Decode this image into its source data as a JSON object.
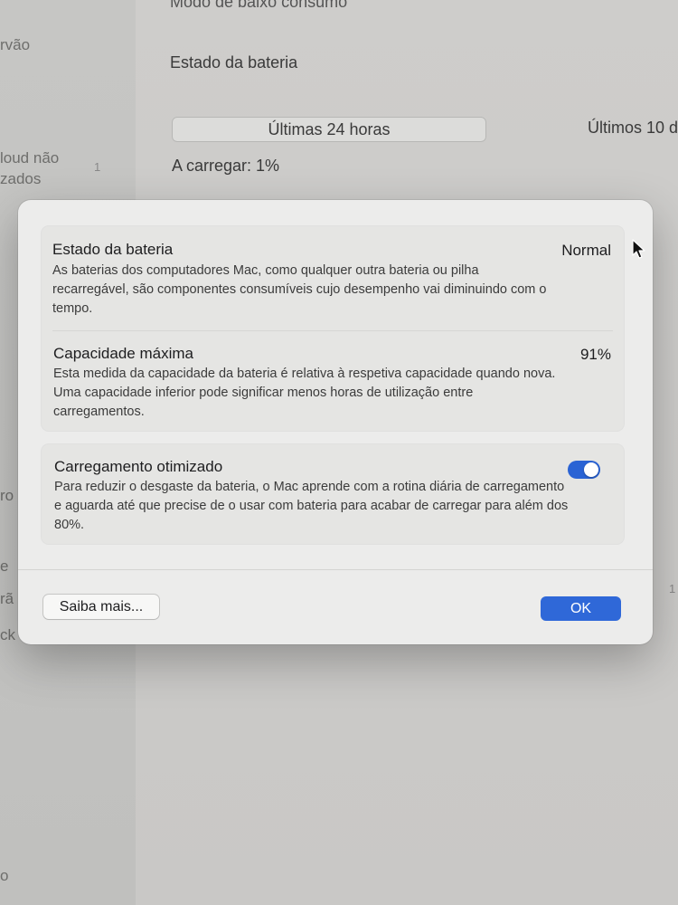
{
  "background": {
    "sidebar": {
      "fragments": [
        "rvão",
        "loud não",
        "zados",
        "ro",
        "e",
        "rã",
        "ck",
        "o"
      ]
    },
    "main": {
      "top_item": "Modo de baixo consumo",
      "section_title": "Estado da bateria",
      "segment_selected": "Últimas 24 horas",
      "segment_other": "Últimos 10 d",
      "charging": "A carregar: 1%",
      "number_left": "1",
      "number_right": "1"
    }
  },
  "dialog": {
    "battery_health": {
      "title": "Estado da bateria",
      "value": "Normal",
      "description": "As baterias dos computadores Mac, como qualquer outra bateria ou pilha recarregável, são componentes consumíveis cujo desempenho vai diminuindo com o tempo."
    },
    "max_capacity": {
      "title": "Capacidade máxima",
      "value": "91%",
      "description": "Esta medida da capacidade da bateria é relativa à respetiva capacidade quando nova. Uma capacidade inferior pode significar menos horas de utilização entre carregamentos."
    },
    "optimized_charging": {
      "title": "Carregamento otimizado",
      "enabled": true,
      "description": "Para reduzir o desgaste da bateria, o Mac aprende com a rotina diária de carregamento e aguarda até que precise de o usar com bateria para acabar de carregar para além dos 80%."
    },
    "learn_more_label": "Saiba mais...",
    "ok_label": "OK"
  },
  "colors": {
    "accent": "#2f68d8",
    "toggle_on": "#2a63d4",
    "dialog_bg": "#ececeb",
    "card_bg": "#e5e5e3"
  },
  "icons": {
    "cursor": "arrow-cursor-icon"
  }
}
